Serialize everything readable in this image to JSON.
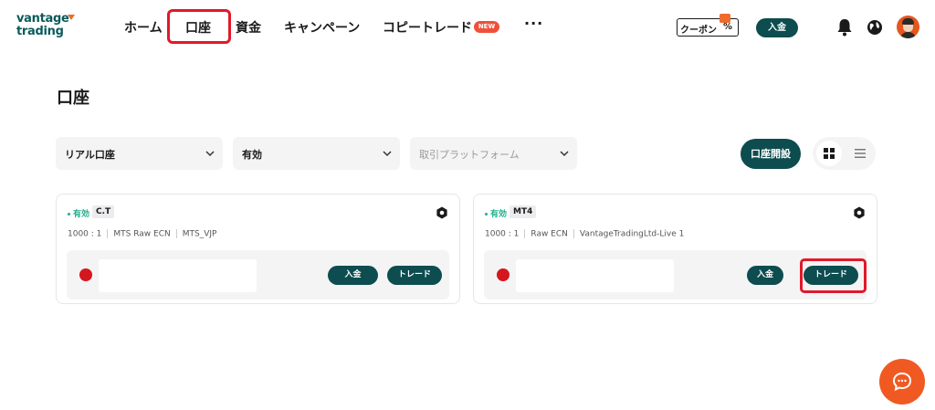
{
  "brand": {
    "logo_line1": "vantage",
    "logo_line2": "trading",
    "accent": "#f06a2a",
    "primary": "#0d4c4f",
    "highlight": "#e0192b"
  },
  "nav": {
    "items": [
      {
        "label": "ホーム"
      },
      {
        "label": "口座",
        "highlighted": true
      },
      {
        "label": "資金"
      },
      {
        "label": "キャンペーン"
      },
      {
        "label": "コピートレード",
        "badge": "NEW"
      }
    ],
    "more_label": "···"
  },
  "header": {
    "coupon_label": "クーポン",
    "coupon_pct": "%",
    "deposit_label": "入金",
    "icons": [
      "bell-icon",
      "globe-icon",
      "avatar"
    ]
  },
  "page": {
    "title": "口座"
  },
  "filters": {
    "account_type": "リアル口座",
    "status": "有効",
    "platform_placeholder": "取引プラットフォーム"
  },
  "toolbar": {
    "open_account_label": "口座開設",
    "view_modes": [
      "grid-icon",
      "list-icon"
    ]
  },
  "accounts": [
    {
      "status": "有効",
      "type": "C.T",
      "leverage": "1000 : 1",
      "account_type": "MTS Raw ECN",
      "server": "MTS_VJP",
      "deposit_label": "入金",
      "trade_label": "トレード"
    },
    {
      "status": "有効",
      "type": "MT4",
      "leverage": "1000 : 1",
      "account_type": "Raw ECN",
      "server": "VantageTradingLtd-Live 1",
      "deposit_label": "入金",
      "trade_label": "トレード"
    }
  ]
}
